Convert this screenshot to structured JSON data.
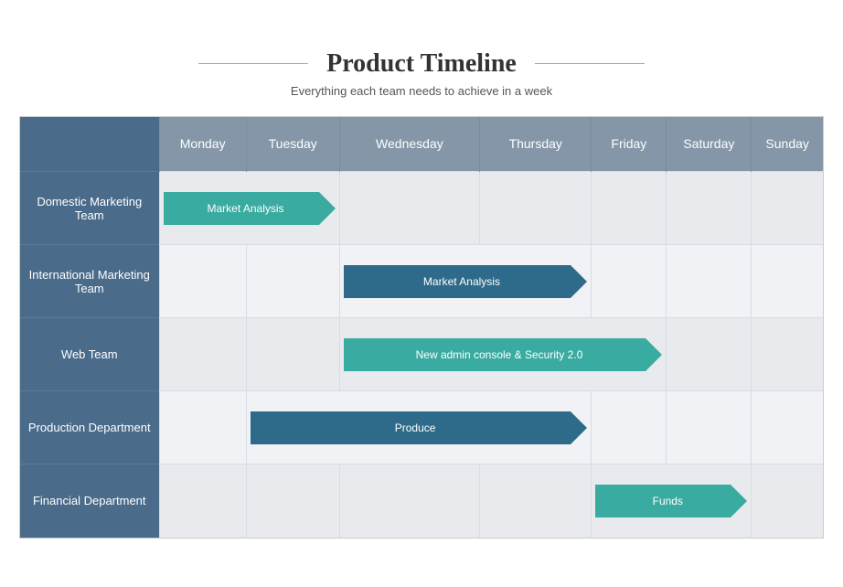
{
  "header": {
    "title": "Product Timeline",
    "subtitle": "Everything each team needs to achieve in a week"
  },
  "days": [
    "Monday",
    "Tuesday",
    "Wednesday",
    "Thursday",
    "Friday",
    "Saturday",
    "Sunday"
  ],
  "rows": [
    {
      "team": "Domestic Marketing Team",
      "task": "Market Analysis",
      "start": 1,
      "end": 3,
      "color": "teal"
    },
    {
      "team": "International Marketing Team",
      "task": "Market Analysis",
      "start": 3,
      "end": 5,
      "color": "dark"
    },
    {
      "team": "Web Team",
      "task": "New admin console & Security 2.0",
      "start": 3,
      "end": 6,
      "color": "teal"
    },
    {
      "team": "Production Department",
      "task": "Produce",
      "start": 2,
      "end": 5,
      "color": "dark"
    },
    {
      "team": "Financial Department",
      "task": "Funds",
      "start": 5,
      "end": 7,
      "color": "teal"
    }
  ],
  "colors": {
    "teal": "#3aaba0",
    "dark": "#2e6b8a",
    "header_team": "#4a6b8a",
    "header_day": "#8496a8"
  }
}
